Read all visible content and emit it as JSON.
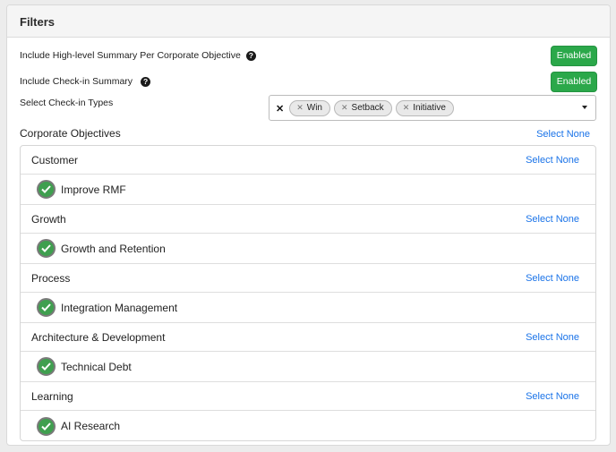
{
  "panel": {
    "title": "Filters"
  },
  "options": {
    "summary": {
      "label": "Include High-level Summary Per Corporate Objective",
      "state": "Enabled"
    },
    "checkin_summary": {
      "label": "Include Check-in Summary",
      "state": "Enabled"
    },
    "checkin_types": {
      "label": "Select Check-in Types",
      "chips": [
        "Win",
        "Setback",
        "Initiative"
      ]
    }
  },
  "objectives": {
    "title": "Corporate Objectives",
    "select_none": "Select None",
    "groups": [
      {
        "name": "Customer",
        "select_none": "Select None",
        "items": [
          "Improve RMF"
        ]
      },
      {
        "name": "Growth",
        "select_none": "Select None",
        "items": [
          "Growth and Retention"
        ]
      },
      {
        "name": "Process",
        "select_none": "Select None",
        "items": [
          "Integration Management"
        ]
      },
      {
        "name": "Architecture & Development",
        "select_none": "Select None",
        "items": [
          "Technical Debt"
        ]
      },
      {
        "name": "Learning",
        "select_none": "Select None",
        "items": [
          "AI Research"
        ]
      }
    ]
  },
  "colors": {
    "enabled": "#2ba84a",
    "link": "#1a73e8",
    "check": "#3f9f4f"
  }
}
